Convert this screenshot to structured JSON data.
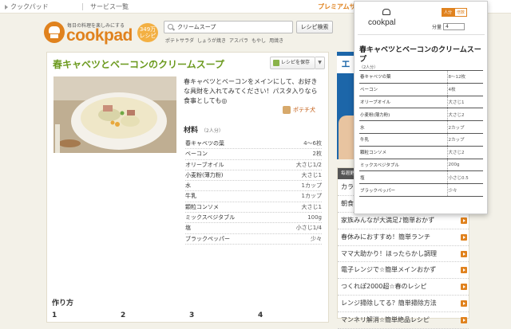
{
  "topbar": {
    "home": "クックパッド",
    "services": "サービス一覧",
    "premium": "プレミアムサ"
  },
  "logo": {
    "tagline": "毎日の料理を楽しみにする",
    "word": "cookpad",
    "count": "349万",
    "count_unit": "レシピ"
  },
  "search": {
    "value": "クリームスープ",
    "button": "レシピ検索",
    "keywords": [
      "ポテトサラダ",
      "しょうが焼き",
      "アスパラ",
      "もやし",
      "用焼き"
    ]
  },
  "recipe": {
    "title": "春キャベツとベーコンのクリームスープ",
    "save": "レシピを保存",
    "description": "春キャベツとベーコンをメインにして、お好きな具財を入れてみてください！パスタ入りなら食事としても◎",
    "author": "ポテチ犬",
    "ingredients_heading": "材料",
    "servings": "（2人分）",
    "ingredients": [
      {
        "name": "春キャベツの葉",
        "qty": "4〜6枚"
      },
      {
        "name": "ベーコン",
        "qty": "2枚"
      },
      {
        "name": "オリーブオイル",
        "qty": "大さじ1/2"
      },
      {
        "name": "小麦粉(薄力粉)",
        "qty": "大さじ1"
      },
      {
        "name": "水",
        "qty": "1カップ"
      },
      {
        "name": "牛乳",
        "qty": "1カップ"
      },
      {
        "name": "顆粒コンソメ",
        "qty": "大さじ1"
      },
      {
        "name": "ミックスベジタブル",
        "qty": "100g"
      },
      {
        "name": "塩",
        "qty": "小さじ1/4"
      },
      {
        "name": "ブラックペッパー",
        "qty": "少々"
      }
    ],
    "steps_heading": "作り方",
    "steps": [
      "1",
      "2",
      "3",
      "4"
    ]
  },
  "ad": {
    "text": "エ"
  },
  "sidebar": {
    "header": "毎週更新",
    "items": [
      "カラ",
      "朝食",
      "家族みんなが大満足♪簡単おかず",
      "春休みにおすすめ！簡単ランチ",
      "ママ大助かり！ほったらかし調理",
      "電子レンジで☆簡単メインおかず",
      "つくれぽ2000超☆春のレシピ",
      "レンジ掃除してる？簡単掃除方法",
      "マンネリ解消☆簡単絶品レシピ"
    ]
  },
  "popup": {
    "brand": "cookpal",
    "toggle_on": "人分",
    "toggle_off": "倍数",
    "servings_label": "分量",
    "servings_value": "4",
    "title": "春キャベツとベーコンのクリームスープ",
    "sub": "（2人分）",
    "rows": [
      {
        "name": "春キャベツの葉",
        "qty": "8〜12枚"
      },
      {
        "name": "ベーコン",
        "qty": "4枚"
      },
      {
        "name": "オリーブオイル",
        "qty": "大さじ1"
      },
      {
        "name": "小麦粉(薄力粉)",
        "qty": "大さじ2"
      },
      {
        "name": "水",
        "qty": "2カップ"
      },
      {
        "name": "牛乳",
        "qty": "2カップ"
      },
      {
        "name": "顆粒コンソメ",
        "qty": "大さじ2"
      },
      {
        "name": "ミックスベジタブル",
        "qty": "200g"
      },
      {
        "name": "塩",
        "qty": "小さじ0.5"
      },
      {
        "name": "ブラックペッパー",
        "qty": "少々"
      }
    ]
  },
  "colors": {
    "brand": "#e0821e",
    "title_green": "#6b9a1e",
    "ad_blue": "#1c66a9"
  }
}
